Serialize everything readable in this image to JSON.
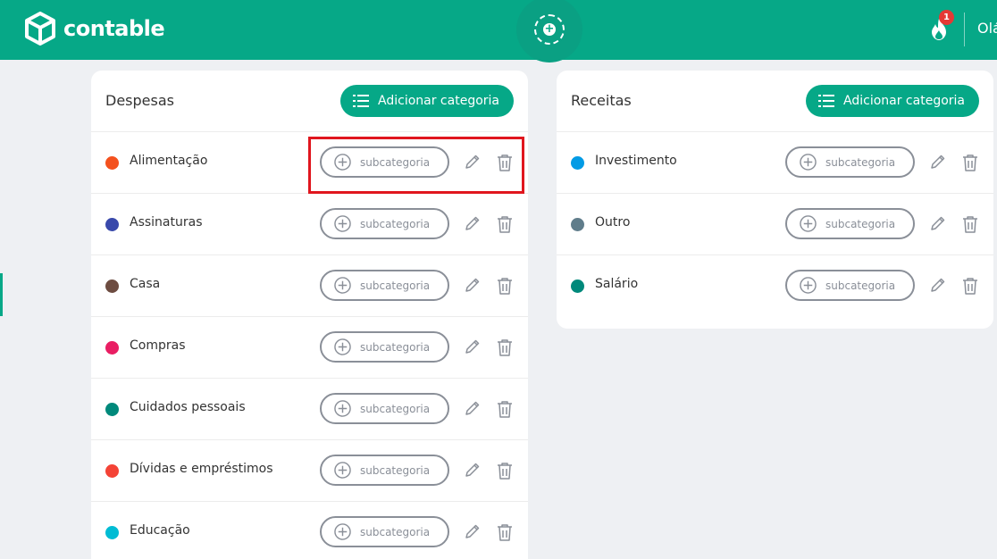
{
  "app": {
    "brand": "contable",
    "greeting": "Olá",
    "notification_count": "1"
  },
  "despesas": {
    "title": "Despesas",
    "add_label": "Adicionar categoria",
    "categories": [
      {
        "name": "Alimentação",
        "color": "#f4511e"
      },
      {
        "name": "Assinaturas",
        "color": "#3949ab"
      },
      {
        "name": "Casa",
        "color": "#6d4c41"
      },
      {
        "name": "Compras",
        "color": "#e91e63"
      },
      {
        "name": "Cuidados pessoais",
        "color": "#00897b"
      },
      {
        "name": "Dívidas e empréstimos",
        "color": "#f44336"
      },
      {
        "name": "Educação",
        "color": "#00bcd4"
      }
    ]
  },
  "receitas": {
    "title": "Receitas",
    "add_label": "Adicionar categoria",
    "categories": [
      {
        "name": "Investimento",
        "color": "#039be5"
      },
      {
        "name": "Outro",
        "color": "#607d8b"
      },
      {
        "name": "Salário",
        "color": "#00897b"
      }
    ]
  },
  "subcategory_label": "subcategoria"
}
